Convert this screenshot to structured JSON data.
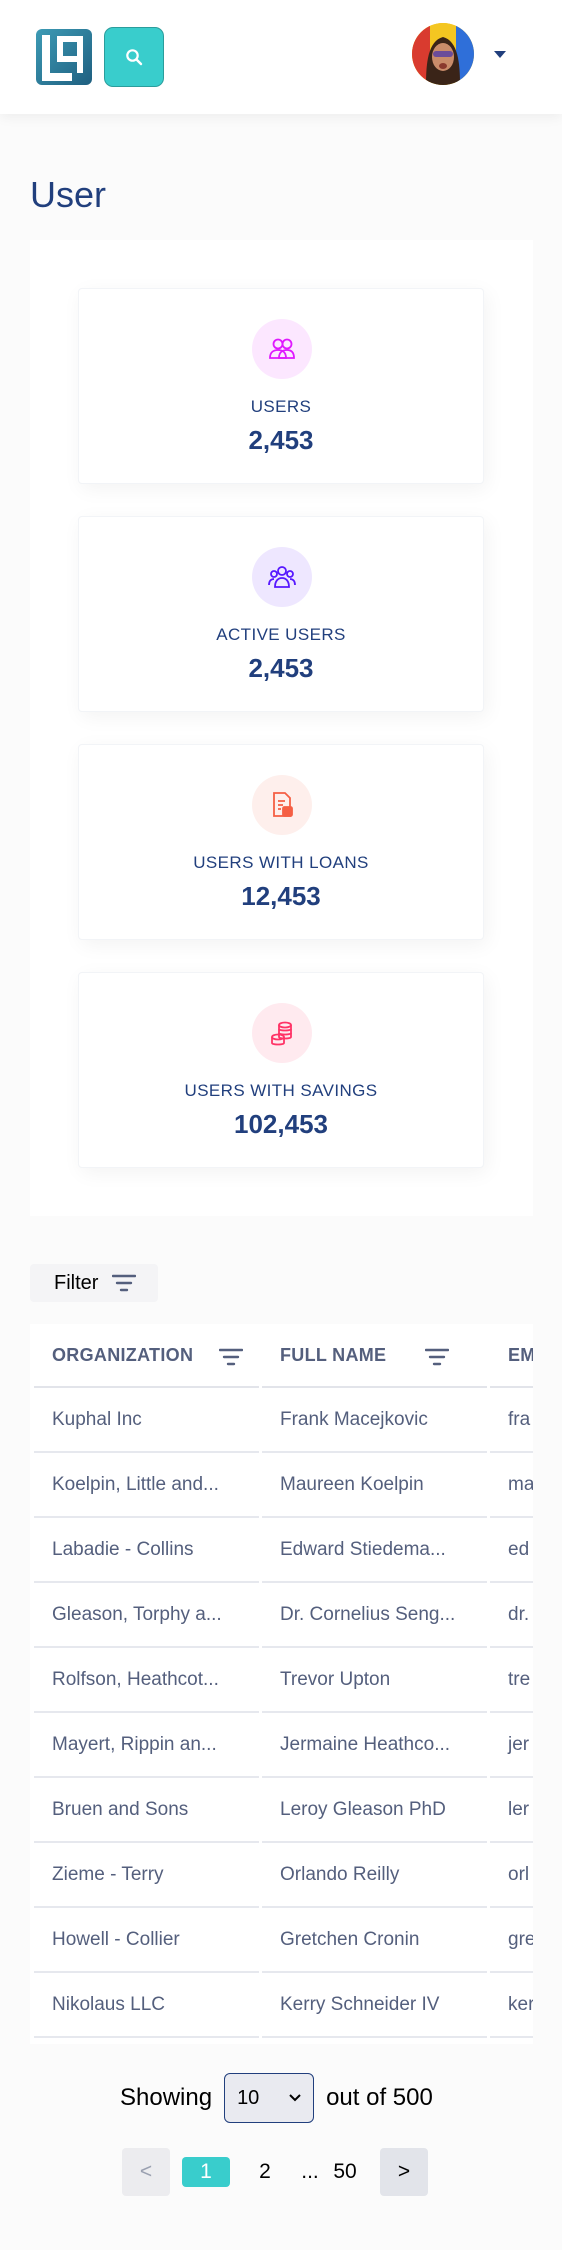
{
  "header": {
    "logo_icon": "lendsqr-logo-icon",
    "search_icon": "search-icon",
    "dropdown_icon": "caret-down-icon"
  },
  "page": {
    "title": "User"
  },
  "stats": [
    {
      "label": "USERS",
      "value": "2,453",
      "icon": "users-icon",
      "color": "#df18ff"
    },
    {
      "label": "ACTIVE USERS",
      "value": "2,453",
      "icon": "active-users-icon",
      "color": "#5718ff"
    },
    {
      "label": "USERS WITH LOANS",
      "value": "12,453",
      "icon": "loan-document-icon",
      "color": "#f55f44"
    },
    {
      "label": "USERS WITH SAVINGS",
      "value": "102,453",
      "icon": "coins-icon",
      "color": "#ff3366"
    }
  ],
  "filter": {
    "label": "Filter",
    "icon": "filter-icon"
  },
  "table": {
    "columns": [
      "ORGANIZATION",
      "FULL NAME",
      "EM"
    ],
    "rows": [
      [
        "Kuphal Inc",
        "Frank Macejkovic",
        "fra"
      ],
      [
        "Koelpin, Little and...",
        "Maureen Koelpin",
        "ma"
      ],
      [
        "Labadie - Collins",
        "Edward Stiedema...",
        "ed"
      ],
      [
        "Gleason, Torphy a...",
        "Dr. Cornelius Seng...",
        "dr."
      ],
      [
        "Rolfson, Heathcot...",
        "Trevor Upton",
        "tre"
      ],
      [
        "Mayert, Rippin an...",
        "Jermaine Heathco...",
        "jer"
      ],
      [
        "Bruen and Sons",
        "Leroy Gleason PhD",
        "ler"
      ],
      [
        "Zieme - Terry",
        "Orlando Reilly",
        "orl"
      ],
      [
        "Howell - Collier",
        "Gretchen Cronin",
        "gre"
      ],
      [
        "Nikolaus LLC",
        "Kerry Schneider IV",
        "ker"
      ]
    ]
  },
  "pagination": {
    "showing_label": "Showing",
    "page_size": "10",
    "out_of_label": "out of 500",
    "prev": "<",
    "pages": [
      "1",
      "2"
    ],
    "ellipsis": "...",
    "last_page": "50",
    "next": ">",
    "current_page": "1"
  },
  "colors": {
    "accent": "#39cdcc",
    "primary_text": "#213f7d",
    "secondary_text": "#545f7d"
  }
}
